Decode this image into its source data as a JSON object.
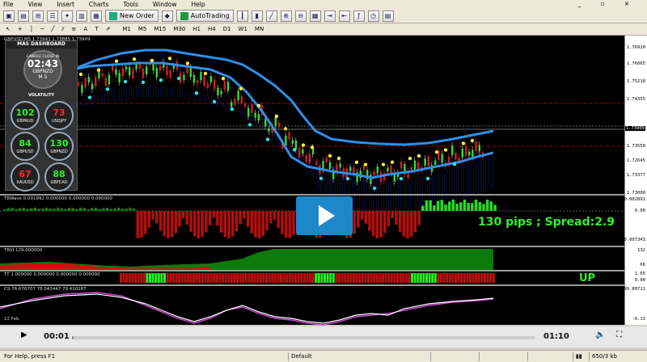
{
  "menu": [
    "File",
    "View",
    "Insert",
    "Charts",
    "Tools",
    "Window",
    "Help"
  ],
  "toolbar": {
    "new_order": "New Order",
    "autotrading": "AutoTrading"
  },
  "timeframes": [
    "M1",
    "M5",
    "M15",
    "M30",
    "H1",
    "H4",
    "D1",
    "W1",
    "MN"
  ],
  "main_chart": {
    "title": "GBPUSD,M5  1.73943 1.73885 1.73909",
    "price_labels": [
      "1.76920",
      "1.76065",
      "1.75210",
      "1.74355",
      "1.73909",
      "1.73550",
      "1.72645",
      "1.73377",
      "1.73000"
    ],
    "current_price": "1.73909"
  },
  "dashboard": {
    "header": "MAS DASHBOARD",
    "candle_label": "CANDLE CLOSE IN",
    "time": "02:43",
    "pair": "GBPNZD",
    "tf": "M 5",
    "volatility_title": "VOLATILITY",
    "pairs": [
      {
        "value": "102",
        "symbol": "GBPAUD",
        "color": "#2ef02e"
      },
      {
        "value": "73",
        "symbol": "USDJPY",
        "color": "#ff2a2a"
      },
      {
        "value": "84",
        "symbol": "GBPUSD",
        "color": "#2ef02e"
      },
      {
        "value": "130",
        "symbol": "GBPNZD",
        "color": "#2ef02e"
      },
      {
        "value": "67",
        "symbol": "XAUUSD",
        "color": "#ff2a2a"
      },
      {
        "value": "88",
        "symbol": "GBPCAD",
        "color": "#2ef02e"
      }
    ]
  },
  "indicators": {
    "trwave": {
      "title": "TRWave 0.001992 0.000000 0.000000 0.000000",
      "top": "0.002891",
      "mid": "0.00",
      "bottom": "-0.007343"
    },
    "trvi": {
      "title": "TRVI 129.000000",
      "top": "132",
      "bottom": "66"
    },
    "tt": {
      "title": "TT 1.000000 0.000000 0.000000 0.000000",
      "top": "1.65",
      "bottom": "0.00"
    },
    "cs": {
      "title": "CS 76.676707 78.043447 79.410187",
      "top": "99.80711",
      "bottom": "-0.13"
    }
  },
  "overlay": {
    "pips_text": "130 pips ; Spread:2.9",
    "up_text": "UP"
  },
  "player": {
    "current_time": "00:01",
    "total_time": "01:10",
    "progress": 0.004
  },
  "status": {
    "help": "For Help, press F1",
    "profile": "Default",
    "traffic": "650/3 kb",
    "date_label": "22 Feb"
  }
}
